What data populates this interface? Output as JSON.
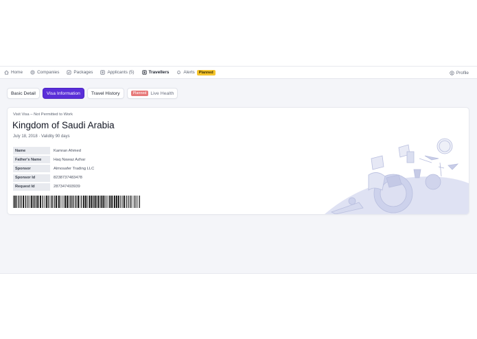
{
  "nav": {
    "items": [
      {
        "label": "Home",
        "icon": "home-icon"
      },
      {
        "label": "Companies",
        "icon": "building-icon"
      },
      {
        "label": "Packages",
        "icon": "package-icon"
      },
      {
        "label": "Applicants (5)",
        "icon": "applicants-icon"
      },
      {
        "label": "Travellers",
        "icon": "traveller-icon",
        "active": true
      },
      {
        "label": "Alerts",
        "icon": "bell-icon"
      }
    ],
    "alerts_badge": "Planned",
    "profile": "Profile"
  },
  "tabs": {
    "basic": "Basic Detail",
    "visa": "Visa Information",
    "history": "Travel History",
    "health_badge": "Planned",
    "health": "Live Health"
  },
  "visa": {
    "type": "Visit Visa – Not Permitted to Work",
    "country": "Kingdom of Saudi Arabia",
    "validity": "July 18, 2018 · Validity 90 days",
    "fields": [
      {
        "label": "Name",
        "value": "Kamran Ahmed"
      },
      {
        "label": "Father's Name",
        "value": "Haq Nawaz Azhar"
      },
      {
        "label": "Sponsor",
        "value": "Almosafer Trading LLC"
      },
      {
        "label": "Sponsor Id",
        "value": "8238737483478"
      },
      {
        "label": "Request Id",
        "value": "287347493939"
      }
    ]
  },
  "colors": {
    "accent": "#5a2fd8",
    "badge_yellow": "#f5c42c",
    "badge_red": "#e77a7a",
    "illustration": "#c9cde8"
  }
}
